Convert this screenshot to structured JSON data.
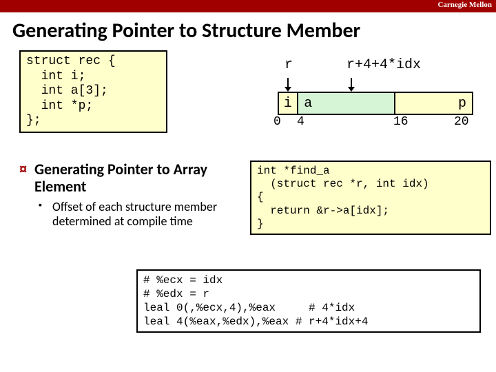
{
  "brand": "Carnegie Mellon",
  "title": "Generating Pointer to Structure Member",
  "struct_code": "struct rec {\n  int i;\n  int a[3];\n  int *p;\n};",
  "layout": {
    "ptr_r": "r",
    "ptr_r2": "r+4+4*idx",
    "cells": {
      "i": "i",
      "a": "a",
      "p": "p"
    },
    "offsets": {
      "o0": "0",
      "o4": "4",
      "o16": "16",
      "o20": "20"
    }
  },
  "bullets": {
    "h": "Generating Pointer to Array Element",
    "sub": "Offset of each structure member determined at compile time"
  },
  "func_code": "int *find_a\n  (struct rec *r, int idx)\n{\n  return &r->a[idx];\n}",
  "asm_code": "# %ecx = idx\n# %edx = r\nleal 0(,%ecx,4),%eax     # 4*idx\nleal 4(%eax,%edx),%eax # r+4*idx+4"
}
